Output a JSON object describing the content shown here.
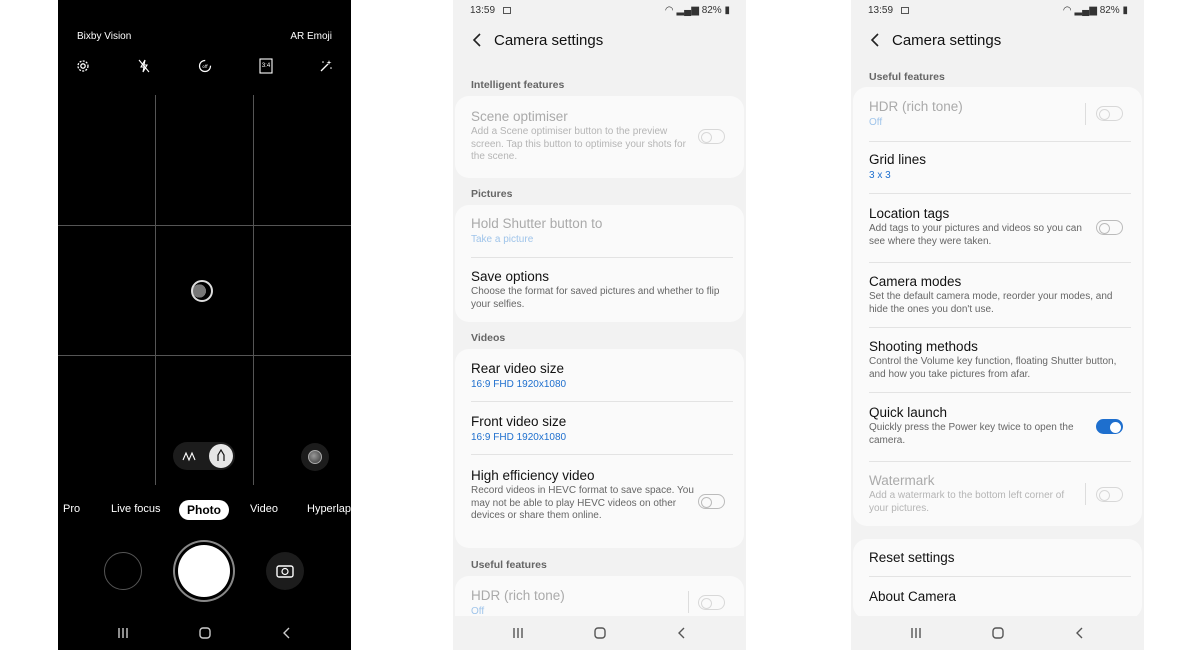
{
  "camera": {
    "top_left_label": "Bixby Vision",
    "top_right_label": "AR Emoji",
    "toolbar_icons": [
      "settings-icon",
      "flash-off-icon",
      "timer-off-icon",
      "aspect-ratio-icon",
      "effects-icon"
    ],
    "aspect_ratio": "3:4",
    "modes": [
      "Pro",
      "Live focus",
      "Photo",
      "Video",
      "Hyperlapse"
    ],
    "active_mode": "Photo"
  },
  "status": {
    "time": "13:59",
    "battery": "82%"
  },
  "settings_left": {
    "title": "Camera settings",
    "sections": {
      "intelligent": "Intelligent features",
      "pictures": "Pictures",
      "videos": "Videos",
      "useful": "Useful features"
    },
    "items": {
      "scene_optimiser": {
        "title": "Scene optimiser",
        "desc": "Add a Scene optimiser button to the preview screen. Tap this button to optimise your shots for the scene.",
        "enabled": false
      },
      "hold_shutter": {
        "title": "Hold Shutter button to",
        "value": "Take a picture"
      },
      "save_options": {
        "title": "Save options",
        "desc": "Choose the format for saved pictures and whether to flip your selfies."
      },
      "rear_video": {
        "title": "Rear video size",
        "value": "16:9 FHD 1920x1080"
      },
      "front_video": {
        "title": "Front video size",
        "value": "16:9 FHD 1920x1080"
      },
      "hevc": {
        "title": "High efficiency video",
        "desc": "Record videos in HEVC format to save space. You may not be able to play HEVC videos on other devices or share them online.",
        "enabled": false
      },
      "hdr": {
        "title": "HDR (rich tone)",
        "value": "Off",
        "enabled": false
      }
    }
  },
  "settings_right": {
    "title": "Camera settings",
    "section_useful": "Useful features",
    "items": {
      "hdr": {
        "title": "HDR (rich tone)",
        "value": "Off",
        "enabled": false
      },
      "grid_lines": {
        "title": "Grid lines",
        "value": "3 x 3"
      },
      "location_tags": {
        "title": "Location tags",
        "desc": "Add tags to your pictures and videos so you can see where they were taken.",
        "enabled": false
      },
      "camera_modes": {
        "title": "Camera modes",
        "desc": "Set the default camera mode, reorder your modes, and hide the ones you don't use."
      },
      "shooting_methods": {
        "title": "Shooting methods",
        "desc": "Control the Volume key function, floating Shutter button, and how you take pictures from afar."
      },
      "quick_launch": {
        "title": "Quick launch",
        "desc": "Quickly press the Power key twice to open the camera.",
        "enabled": true
      },
      "watermark": {
        "title": "Watermark",
        "desc": "Add a watermark to the bottom left corner of your pictures.",
        "enabled": false
      },
      "reset": {
        "title": "Reset settings"
      },
      "about": {
        "title": "About Camera"
      }
    }
  },
  "colors": {
    "accent": "#1e6fce",
    "settings_bg": "#f2f2f2",
    "card_bg": "#fafafa",
    "camera_bg": "#000000"
  }
}
